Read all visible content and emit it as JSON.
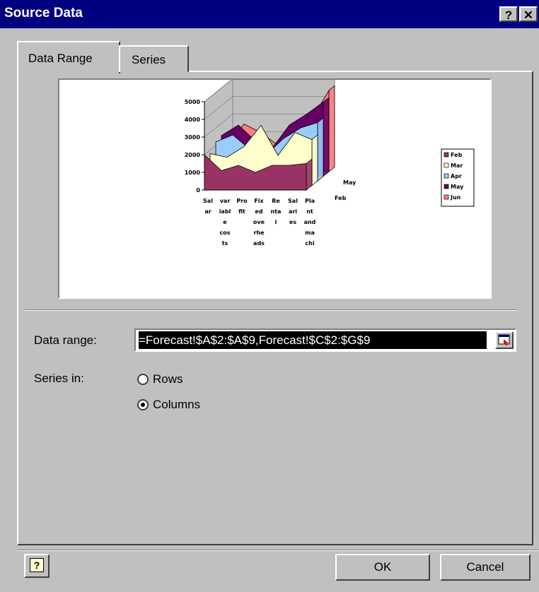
{
  "window": {
    "title": "Source Data",
    "help_glyph": "?",
    "close_glyph": "✕"
  },
  "tabs": [
    {
      "label": "Data Range",
      "active": true
    },
    {
      "label": "Series",
      "active": false
    }
  ],
  "chart_data": {
    "type": "area",
    "title": "",
    "categories": [
      "Salaries",
      "Variable costs",
      "Profit",
      "Fixed overheads",
      "Rental",
      "Salaries",
      "Plant and machinery"
    ],
    "category_tick_labels": [
      [
        "Sal",
        "ar"
      ],
      [
        "var",
        "iabl",
        "e",
        "cos",
        "ts"
      ],
      [
        "Pro",
        "fit"
      ],
      [
        "Fix",
        "ed",
        "ove",
        "rhe",
        "ads"
      ],
      [
        "Re",
        "nta",
        "l"
      ],
      [
        "Sal",
        "ari",
        "es"
      ],
      [
        "Pla",
        "nt",
        "and",
        "ma",
        "chi"
      ]
    ],
    "y_ticks": [
      "5000",
      "4000",
      "3000",
      "2000",
      "1000",
      "0"
    ],
    "ylim": [
      0,
      5000
    ],
    "depth_labels": [
      "May",
      "Feb"
    ],
    "legend_position": "right",
    "series": [
      {
        "name": "Feb",
        "color": "#993366",
        "values": [
          2000,
          1100,
          1400,
          1000,
          1400,
          1400,
          1500
        ]
      },
      {
        "name": "Mar",
        "color": "#ffffcc",
        "values": [
          1800,
          1600,
          2200,
          3400,
          1700,
          3000,
          2600
        ]
      },
      {
        "name": "Apr",
        "color": "#99ccff",
        "values": [
          2200,
          2600,
          1800,
          1500,
          2400,
          3000,
          3300
        ]
      },
      {
        "name": "May",
        "color": "#660066",
        "values": [
          2300,
          2900,
          2000,
          1600,
          2900,
          3500,
          4200
        ]
      },
      {
        "name": "Jun",
        "color": "#ff8080",
        "values": [
          1400,
          2700,
          2200,
          1500,
          2600,
          3000,
          4600
        ]
      }
    ]
  },
  "form": {
    "data_range_label": "Data range:",
    "data_range_value": "=Forecast!$A$2:$A$9,Forecast!$C$2:$G$9",
    "series_in_label": "Series in:",
    "series_in_options": [
      {
        "label": "Rows",
        "selected": false
      },
      {
        "label": "Columns",
        "selected": true
      }
    ]
  },
  "footer": {
    "help_glyph": "?",
    "ok_label": "OK",
    "cancel_label": "Cancel"
  }
}
